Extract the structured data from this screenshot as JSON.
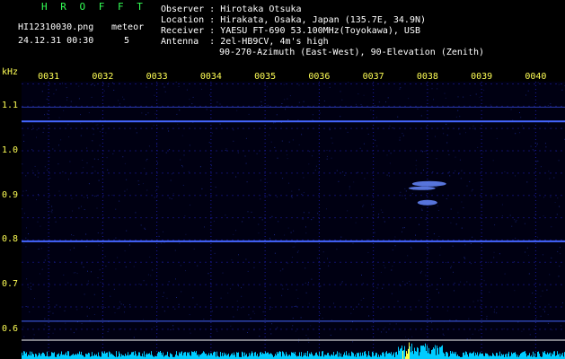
{
  "header": {
    "brand": "H R O F F T",
    "filename": "HI12310030.png",
    "datetime": "24.12.31 00:30",
    "meteor_label": "meteor",
    "meteor_count": "5",
    "observer": "Observer : Hirotaka Otsuka",
    "location": "Location : Hirakata, Osaka, Japan (135.7E, 34.9N)",
    "receiver": "Receiver : YAESU FT-690 53.100MHz(Toyokawa), USB",
    "antenna": "Antenna  : 2el-HB9CV, 4m's high",
    "antenna2": "90-270-Azimuth (East-West), 90-Elevation (Zenith)"
  },
  "axis": {
    "unit": "kHz",
    "time_ticks": [
      "0031",
      "0032",
      "0033",
      "0034",
      "0035",
      "0036",
      "0037",
      "0038",
      "0039",
      "0040"
    ],
    "freq_ticks": [
      "1.1",
      "1.0",
      "0.9",
      "0.8",
      "0.7",
      "0.6"
    ]
  },
  "colors": {
    "background": "#000000",
    "grid": "#1a1aa0",
    "signal": "#4466ff",
    "axis_label": "#ffff55",
    "brand": "#33ff55",
    "noise": "#00ccff"
  },
  "signal_bands_khz": [
    1.066,
    0.797,
    0.618
  ],
  "meteor_echo": {
    "time_min": 37.75,
    "freq_khz": 0.92
  }
}
